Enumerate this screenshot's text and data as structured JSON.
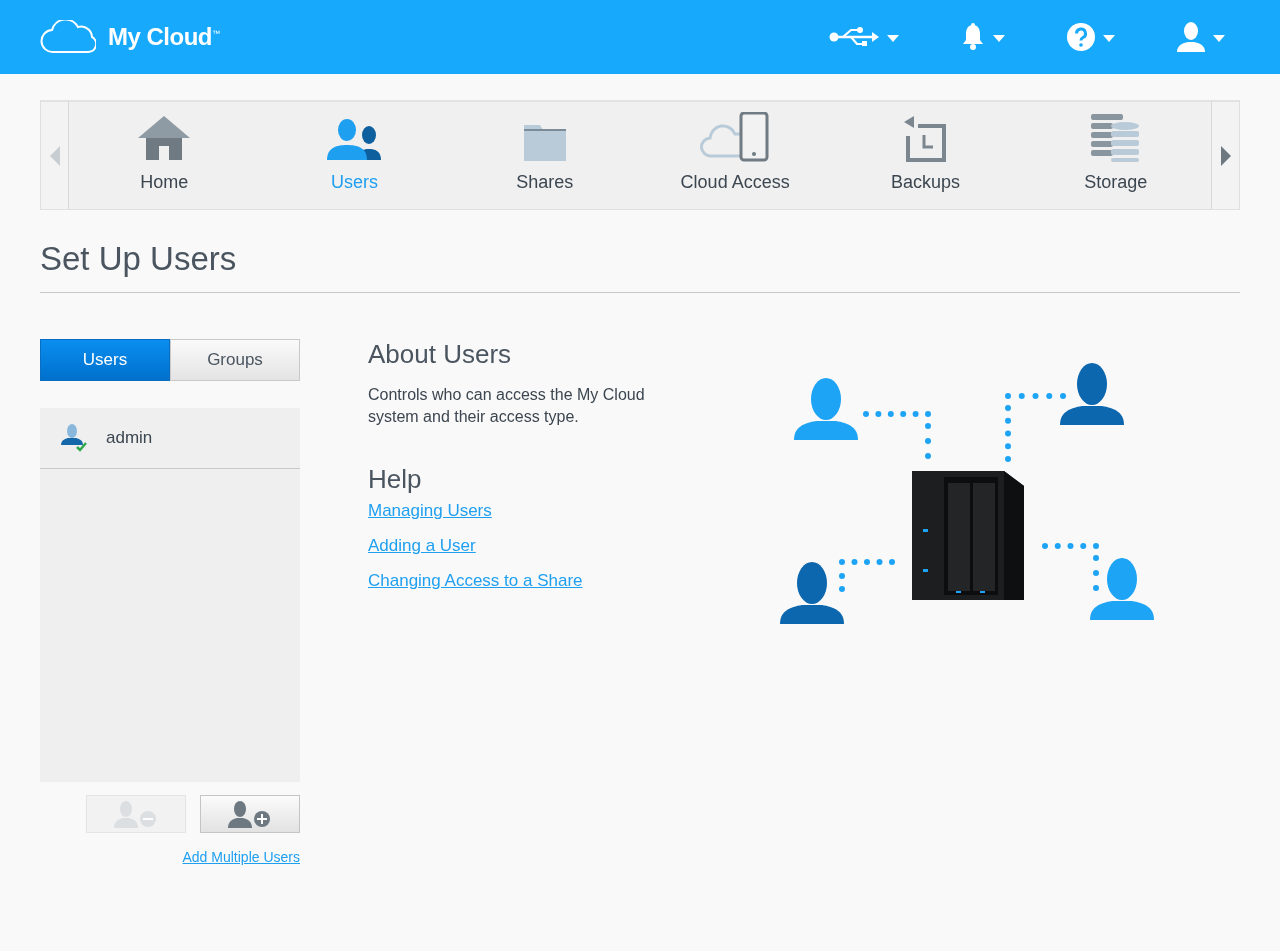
{
  "header": {
    "logo": "My Cloud$^{™}$",
    "icons": [
      {
        "kind": "usb"
      },
      {
        "kind": "bell"
      },
      {
        "kind": "help"
      },
      {
        "kind": "user"
      }
    ]
  },
  "nav": {
    "items": [
      {
        "kind": "home",
        "label": "Home",
        "selected": false
      },
      {
        "kind": "users",
        "label": "Users",
        "selected": true
      },
      {
        "kind": "shares",
        "label": "Shares",
        "selected": false
      },
      {
        "kind": "cloud",
        "label": "Cloud Access",
        "selected": false
      },
      {
        "kind": "backups",
        "label": "Backups",
        "selected": false
      },
      {
        "kind": "storage",
        "label": "Storage",
        "selected": false
      }
    ],
    "prev_disabled": true,
    "next_disabled": false
  },
  "page_title": "Set Up Users",
  "tabs": [
    {
      "label": "Users",
      "selected": true
    },
    {
      "label": "Groups",
      "selected": false
    }
  ],
  "users": [
    {
      "name": "admin",
      "selected": false
    }
  ],
  "buttons": [
    {
      "kind": "remove",
      "disabled": true
    },
    {
      "kind": "add",
      "disabled": false
    }
  ],
  "add_multiple_link": "Add Multiple Users",
  "about": {
    "title": "About Users",
    "text": "Controls who can access the My Cloud system and their access type."
  },
  "help": {
    "title": "Help",
    "links": [
      "Managing Users",
      "Adding a User",
      "Changing Access to a Share"
    ]
  }
}
